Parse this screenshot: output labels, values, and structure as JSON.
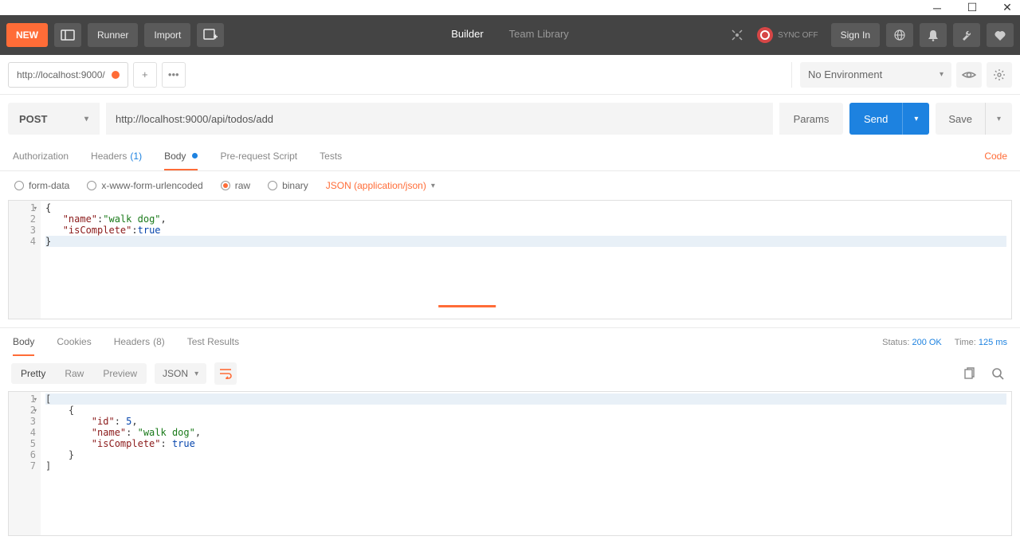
{
  "titlebar": {
    "controls": [
      "minimize",
      "maximize",
      "close"
    ]
  },
  "toolbar": {
    "new": "NEW",
    "runner": "Runner",
    "import": "Import",
    "builder": "Builder",
    "team_library": "Team Library",
    "sync": "SYNC OFF",
    "signin": "Sign In"
  },
  "env": {
    "label": "No Environment"
  },
  "tabs": {
    "active": "http://localhost:9000/"
  },
  "request": {
    "method": "POST",
    "url": "http://localhost:9000/api/todos/add",
    "params": "Params",
    "send": "Send",
    "save": "Save"
  },
  "reqtabs": {
    "auth": "Authorization",
    "headers": "Headers",
    "headers_count": "(1)",
    "body": "Body",
    "prereq": "Pre-request Script",
    "tests": "Tests",
    "code": "Code"
  },
  "bodymode": {
    "form": "form-data",
    "xwww": "x-www-form-urlencoded",
    "raw": "raw",
    "binary": "binary",
    "content_type": "JSON (application/json)"
  },
  "reqbody": {
    "ln1": {
      "punct": "{"
    },
    "ln2": {
      "key": "\"name\"",
      "colon": ":",
      "val": "\"walk dog\"",
      "comma": ","
    },
    "ln3": {
      "key": "\"isComplete\"",
      "colon": ":",
      "val": "true"
    },
    "ln4": {
      "punct": "}"
    },
    "numbers": [
      "1",
      "2",
      "3",
      "4"
    ]
  },
  "restabs": {
    "body": "Body",
    "cookies": "Cookies",
    "headers": "Headers",
    "headers_count": "(8)",
    "tests": "Test Results",
    "status_label": "Status:",
    "status_value": "200 OK",
    "time_label": "Time:",
    "time_value": "125 ms"
  },
  "resview": {
    "pretty": "Pretty",
    "raw": "Raw",
    "preview": "Preview",
    "lang": "JSON"
  },
  "resbody": {
    "numbers": [
      "1",
      "2",
      "3",
      "4",
      "5",
      "6",
      "7"
    ],
    "l1": "[",
    "l2": "    {",
    "l3": {
      "key": "\"id\"",
      "val": "5"
    },
    "l4": {
      "key": "\"name\"",
      "val": "\"walk dog\""
    },
    "l5": {
      "key": "\"isComplete\"",
      "val": "true"
    },
    "l6": "    }",
    "l7": "]"
  }
}
